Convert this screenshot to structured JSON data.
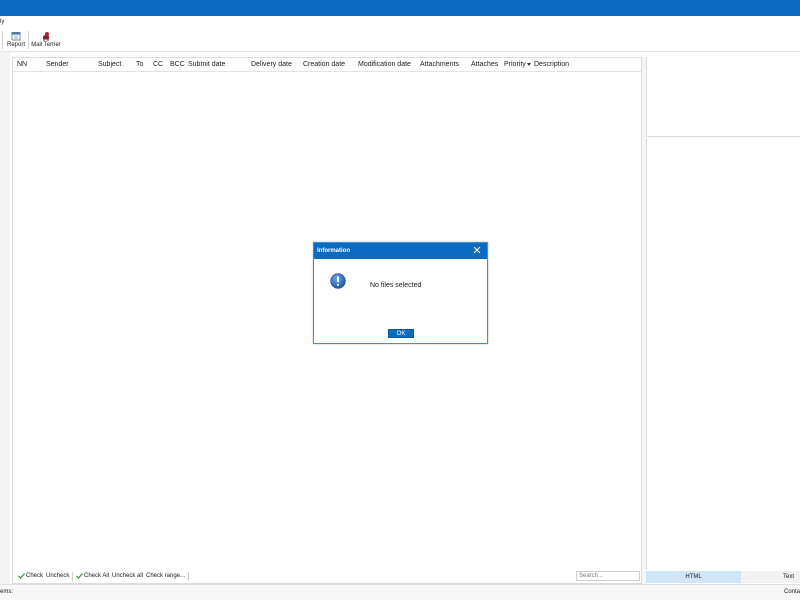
{
  "colors": {
    "accent": "#0A6BC1",
    "tab_active": "#CFE6FA"
  },
  "menubar": {
    "fragment": "ly"
  },
  "toolbar": {
    "report_label": "Report",
    "mailterrier_label": "Mail Terrier",
    "icons": [
      "calendar-icon",
      "mail-terrier-icon"
    ]
  },
  "table": {
    "columns": [
      "NN",
      "Sender",
      "Subject",
      "To",
      "CC",
      "BCC",
      "Submit date",
      "Delivery date",
      "Creation date",
      "Modification date",
      "Attachments",
      "Attaches",
      "Priority",
      "Description"
    ]
  },
  "bottombar": {
    "check": "Check",
    "uncheck": "Uncheck",
    "check_all": "Check All",
    "uncheck_all": "Uncheck all",
    "check_range": "Check range...",
    "search_placeholder": "Search..."
  },
  "preview_tabs": {
    "html": "HTML",
    "text": "Text"
  },
  "statusbar": {
    "left": "ems:",
    "right": "Conta"
  },
  "dialog": {
    "title": "Information",
    "message": "No files selected",
    "ok": "OK",
    "icon": "info-exclamation-icon"
  }
}
